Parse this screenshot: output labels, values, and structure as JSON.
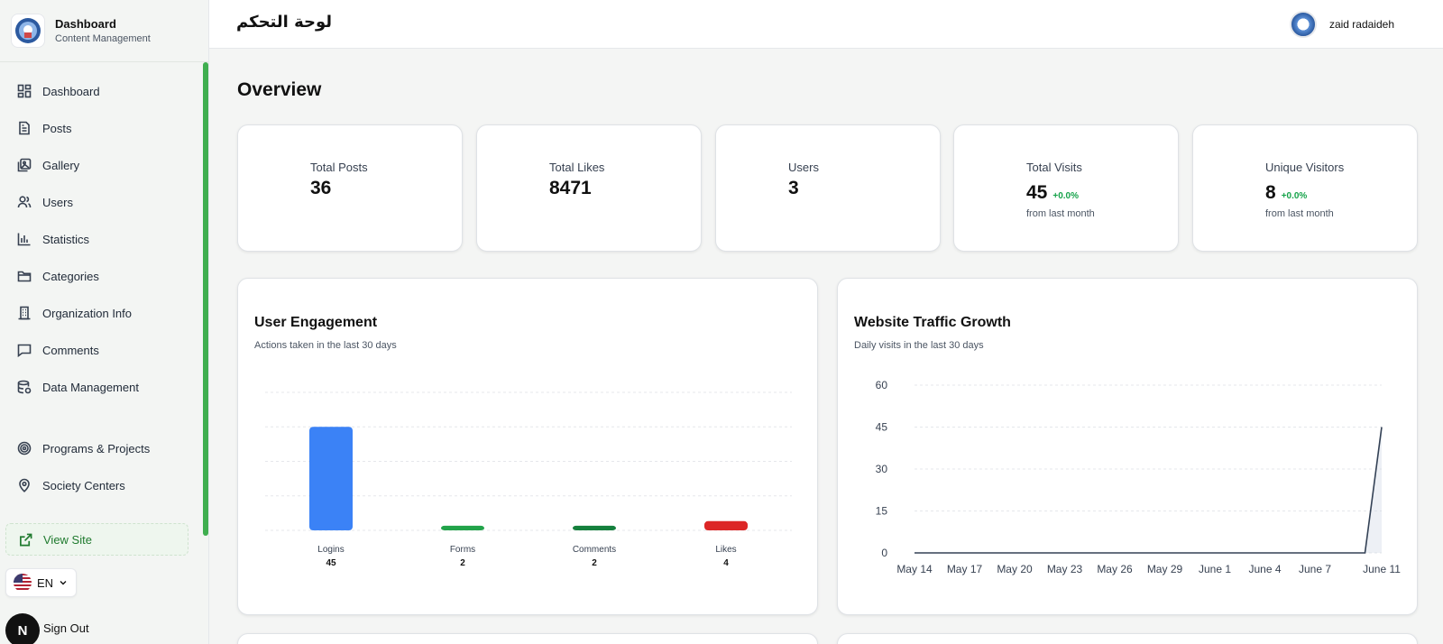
{
  "sidebar": {
    "brand_title": "Dashboard",
    "brand_subtitle": "Content Management",
    "items": [
      {
        "label": "Dashboard",
        "icon": "grid-icon"
      },
      {
        "label": "Posts",
        "icon": "document-icon"
      },
      {
        "label": "Gallery",
        "icon": "gallery-icon"
      },
      {
        "label": "Users",
        "icon": "users-icon"
      },
      {
        "label": "Statistics",
        "icon": "bar-chart-icon"
      },
      {
        "label": "Categories",
        "icon": "folder-icon"
      },
      {
        "label": "Organization Info",
        "icon": "building-icon"
      },
      {
        "label": "Comments",
        "icon": "comment-icon"
      },
      {
        "label": "Data Management",
        "icon": "database-icon"
      },
      {
        "label": "Programs & Projects",
        "icon": "target-icon"
      },
      {
        "label": "Society Centers",
        "icon": "map-pin-icon"
      }
    ],
    "view_site": "View Site",
    "language": "EN",
    "sign_out": "Sign Out",
    "sign_out_badge": "N"
  },
  "header": {
    "title_ar": "لوحة التحكم",
    "user_name": "zaid radaideh"
  },
  "main": {
    "heading": "Overview",
    "stats": [
      {
        "label": "Total Posts",
        "value": "36",
        "color": "#3b82f6",
        "icon": "document-icon"
      },
      {
        "label": "Total Likes",
        "value": "8471",
        "color": "#ef3b3b",
        "icon": "heart-icon"
      },
      {
        "label": "Users",
        "value": "3",
        "color": "#2e7d32",
        "icon": "users-icon"
      },
      {
        "label": "Total Visits",
        "value": "45",
        "change": "+0.0%",
        "sub": "from last month",
        "color": "#3b82f6",
        "icon": "eye-icon"
      },
      {
        "label": "Unique Visitors",
        "value": "8",
        "change": "+0.0%",
        "sub": "from last month",
        "color": "#475569",
        "icon": "users-icon"
      }
    ]
  },
  "chart_data": [
    {
      "type": "bar",
      "title": "User Engagement",
      "subtitle": "Actions taken in the last 30 days",
      "categories": [
        "Logins",
        "Forms",
        "Comments",
        "Likes"
      ],
      "values": [
        45,
        2,
        2,
        4
      ],
      "value_labels": [
        "45",
        "2",
        "2",
        "4"
      ],
      "colors": [
        "#3b82f6",
        "#22a34a",
        "#15803d",
        "#dc2626"
      ],
      "grid": true
    },
    {
      "type": "line",
      "title": "Website Traffic Growth",
      "subtitle": "Daily visits in the last 30 days",
      "x_ticks": [
        "May 14",
        "May 17",
        "May 20",
        "May 23",
        "May 26",
        "May 29",
        "June 1",
        "June 4",
        "June 7",
        "June 11"
      ],
      "y_ticks": [
        "0",
        "15",
        "30",
        "45",
        "60"
      ],
      "ylim": [
        0,
        60
      ],
      "series": [
        {
          "values_by_date": [
            [
              "May 14",
              0
            ],
            [
              "June 10",
              0
            ],
            [
              "June 11",
              45
            ]
          ]
        }
      ],
      "line_color": "#334155",
      "grid": true
    }
  ]
}
